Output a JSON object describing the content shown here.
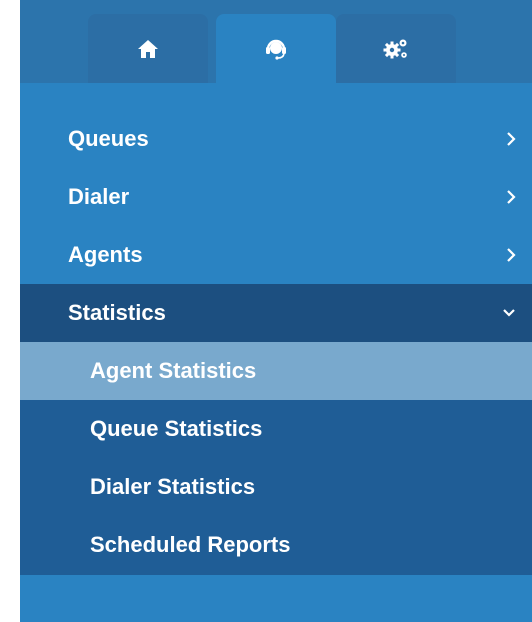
{
  "tabs": [
    {
      "icon": "home-icon",
      "active": false
    },
    {
      "icon": "headset-agent-icon",
      "active": true
    },
    {
      "icon": "gears-settings-icon",
      "active": false
    }
  ],
  "menu": {
    "queues": "Queues",
    "dialer": "Dialer",
    "agents": "Agents",
    "statistics": "Statistics"
  },
  "submenu": {
    "agent_statistics": "Agent Statistics",
    "queue_statistics": "Queue Statistics",
    "dialer_statistics": "Dialer Statistics",
    "scheduled_reports": "Scheduled Reports"
  },
  "colors": {
    "sidebar_bg": "#2a83c2",
    "tabbar_bg": "#2c74ac",
    "expanded_item_bg": "#1c4f80",
    "submenu_bg": "#1f5d96",
    "active_subitem_bg": "#79a9cd",
    "text": "#ffffff"
  }
}
